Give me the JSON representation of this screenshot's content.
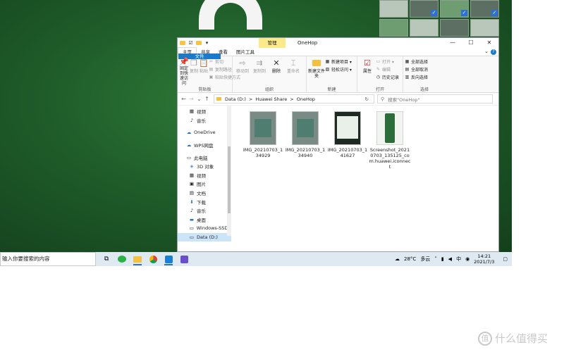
{
  "window": {
    "title": "OneHop",
    "context_tab": "管理",
    "controls": [
      "—",
      "☐",
      "✕"
    ]
  },
  "ribbon_tabs": [
    "文件",
    "主页",
    "共享",
    "查看",
    "图片工具"
  ],
  "ribbon": {
    "clipboard": {
      "pin": "固定到快速访问",
      "copy": "复制",
      "paste": "粘贴",
      "cut": "剪切",
      "copy_path": "复制路径",
      "paste_shortcut": "粘贴快捷方式",
      "label": "剪贴板"
    },
    "organize": {
      "move_to": "移动到",
      "copy_to": "复制到",
      "delete": "删除",
      "rename": "重命名",
      "label": "组织"
    },
    "new": {
      "new_folder": "新建文件夹",
      "new_item": "新建项目 ▾",
      "easy_access": "轻松访问 ▾",
      "label": "新建"
    },
    "open": {
      "properties": "属性",
      "open": "打开 ▾",
      "edit": "编辑",
      "history": "历史记录",
      "label": "打开"
    },
    "select": {
      "select_all": "全部选择",
      "select_none": "全部取消",
      "invert": "反向选择",
      "label": "选择"
    }
  },
  "address": {
    "crumbs": [
      "Data (D:)",
      ">",
      "Huawei Share",
      ">",
      "OneHop"
    ],
    "search_placeholder": "搜索\"OneHop\""
  },
  "nav_pane": [
    {
      "label": "视频",
      "icon": "video-icon"
    },
    {
      "label": "音乐",
      "icon": "music-icon"
    },
    {
      "label": "OneDrive",
      "icon": "cloud-icon"
    },
    {
      "label": "WPS网盘",
      "icon": "cloud-drive-icon"
    },
    {
      "label": "此电脑",
      "icon": "computer-icon"
    },
    {
      "label": "3D 对象",
      "icon": "3d-objects-icon"
    },
    {
      "label": "视频",
      "icon": "video-icon"
    },
    {
      "label": "图片",
      "icon": "pictures-icon"
    },
    {
      "label": "文档",
      "icon": "documents-icon"
    },
    {
      "label": "下载",
      "icon": "download-icon"
    },
    {
      "label": "音乐",
      "icon": "music-icon"
    },
    {
      "label": "桌面",
      "icon": "desktop-icon"
    },
    {
      "label": "Windows-SSD (",
      "icon": "drive-icon"
    },
    {
      "label": "Data (D:)",
      "icon": "drive-icon",
      "selected": true
    }
  ],
  "files": [
    {
      "name": "IMG_20210703_134929"
    },
    {
      "name": "IMG_20210703_134940"
    },
    {
      "name": "IMG_20210703_141627"
    },
    {
      "name": "Screenshot_20210703_135125_com.huawei.iconnect"
    }
  ],
  "taskbar": {
    "search_placeholder": "输入你要搜索的内容",
    "weather_temp": "28°C",
    "weather_desc": "多云",
    "time": "14:21",
    "date": "2021/7/3"
  },
  "watermark": {
    "badge": "值",
    "text": "什么值得买"
  }
}
